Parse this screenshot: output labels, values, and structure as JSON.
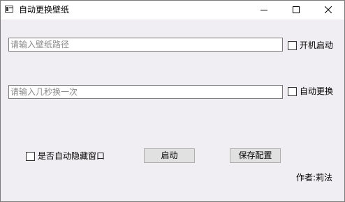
{
  "window": {
    "title": "自动更换壁纸",
    "controls": {
      "minimize": "minimize-icon",
      "maximize": "maximize-icon",
      "close": "close-icon"
    }
  },
  "form": {
    "wallpaper_path": {
      "value": "",
      "placeholder": "请输入壁纸路径"
    },
    "interval": {
      "value": "",
      "placeholder": "请输入几秒换一次"
    },
    "startup_checkbox": {
      "label": "开机启动",
      "checked": false
    },
    "auto_change_checkbox": {
      "label": "自动更换",
      "checked": false
    },
    "auto_hide_checkbox": {
      "label": "是否自动隐藏窗口",
      "checked": false
    }
  },
  "actions": {
    "start_label": "启动",
    "save_label": "保存配置"
  },
  "footer": {
    "author": "作者:莉法"
  },
  "colors": {
    "window_background": "#f0eef2",
    "titlebar_background": "#ffffff",
    "button_face": "#e1e1e1",
    "input_border": "#7a7a7a"
  }
}
